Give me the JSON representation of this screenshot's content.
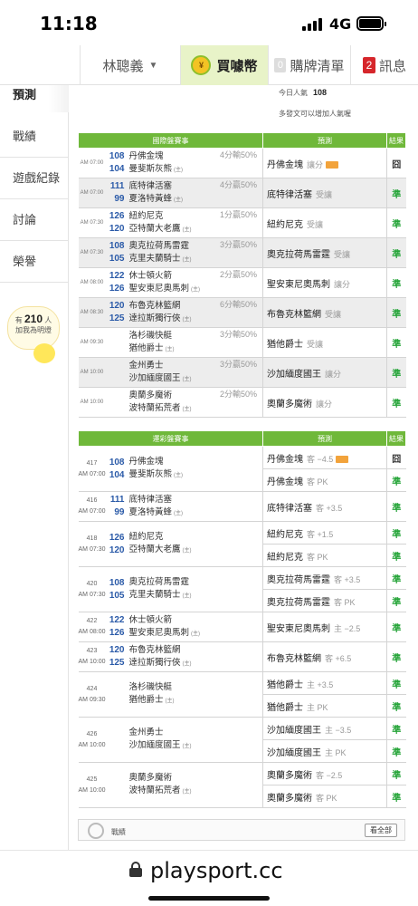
{
  "status": {
    "time": "11:18",
    "network": "4G"
  },
  "nav": {
    "username": "林聰義",
    "buy_label": "買噱幣",
    "cart_count": "0",
    "cart_label": "購牌清單",
    "msg_count": "2",
    "msg_label": "訊息"
  },
  "sidebar": {
    "items": [
      {
        "label": "預測"
      },
      {
        "label": "戰績"
      },
      {
        "label": "遊戲紀錄"
      },
      {
        "label": "討論"
      },
      {
        "label": "榮譽"
      }
    ],
    "pop_prefix": "有",
    "pop_count": "210",
    "pop_suffix": "人",
    "pop_line2": "加我為明燈"
  },
  "popularity": {
    "today_label": "今日人氣",
    "today_value": "108",
    "hint": "多發文可以增加人氣喔"
  },
  "intl": {
    "headers": [
      "國際盤賽事",
      "預測",
      "結果"
    ],
    "rows": [
      {
        "time": "AM 07:00",
        "n1": "108",
        "n2": "104",
        "t1": "丹佛金塊",
        "t2": "曼斐斯灰熊",
        "home": "(主)",
        "o1": "4分輸50%",
        "o2": "",
        "pick": "丹佛金塊",
        "pick_sub": "讓分",
        "hot": true,
        "result": "囧",
        "win": false
      },
      {
        "time": "AM 07:00",
        "n1": "111",
        "n2": "99",
        "t1": "底特律活塞",
        "t2": "夏洛特黃蜂",
        "home": "(主)",
        "o1": "",
        "o2": "4分贏50%",
        "pick": "底特律活塞",
        "pick_sub": "受讓",
        "hot": false,
        "result": "準",
        "win": true
      },
      {
        "time": "AM 07:30",
        "n1": "126",
        "n2": "120",
        "t1": "紐約尼克",
        "t2": "亞特蘭大老鷹",
        "home": "(主)",
        "o1": "",
        "o2": "1分贏50%",
        "pick": "紐約尼克",
        "pick_sub": "受讓",
        "hot": false,
        "result": "準",
        "win": true
      },
      {
        "time": "AM 07:30",
        "n1": "108",
        "n2": "105",
        "t1": "奧克拉荷馬雷霆",
        "t2": "克里夫蘭騎士",
        "home": "(主)",
        "o1": "",
        "o2": "3分贏50%",
        "pick": "奧克拉荷馬雷霆",
        "pick_sub": "受讓",
        "hot": false,
        "result": "準",
        "win": true
      },
      {
        "time": "AM 08:00",
        "n1": "122",
        "n2": "126",
        "t1": "休士頓火箭",
        "t2": "聖安東尼奧馬刺",
        "home": "(主)",
        "o1": "",
        "o2": "2分贏50%",
        "pick": "聖安東尼奧馬刺",
        "pick_sub": "讓分",
        "hot": false,
        "result": "準",
        "win": true
      },
      {
        "time": "AM 08:30",
        "n1": "120",
        "n2": "125",
        "t1": "布魯克林籃網",
        "t2": "達拉斯獨行俠",
        "home": "(主)",
        "o1": "",
        "o2": "6分輸50%",
        "pick": "布魯克林籃網",
        "pick_sub": "受讓",
        "hot": false,
        "result": "準",
        "win": true
      },
      {
        "time": "AM 09:30",
        "n1": "",
        "n2": "",
        "t1": "洛杉磯快艇",
        "t2": "猶他爵士",
        "home": "(主)",
        "o1": "3分輸50%",
        "o2": "",
        "pick": "猶他爵士",
        "pick_sub": "受讓",
        "hot": false,
        "result": "準",
        "win": true
      },
      {
        "time": "AM 10:00",
        "n1": "",
        "n2": "",
        "t1": "金州勇士",
        "t2": "沙加緬度國王",
        "home": "(主)",
        "o1": "",
        "o2": "3分贏50%",
        "pick": "沙加緬度國王",
        "pick_sub": "讓分",
        "hot": false,
        "result": "準",
        "win": true
      },
      {
        "time": "AM 10:00",
        "n1": "",
        "n2": "",
        "t1": "奧蘭多魔術",
        "t2": "波特蘭拓荒者",
        "home": "(主)",
        "o1": "2分輸50%",
        "o2": "",
        "pick": "奧蘭多魔術",
        "pick_sub": "讓分",
        "hot": false,
        "result": "準",
        "win": true
      }
    ]
  },
  "lottery": {
    "headers": [
      "運彩盤賽事",
      "預測",
      "結果"
    ],
    "rows": [
      {
        "gid": "417",
        "time": "AM 07:00",
        "n1": "108",
        "n2": "104",
        "t1": "丹佛金塊",
        "t2": "曼斐斯灰熊",
        "home": "(主)",
        "picks": [
          {
            "team": "丹佛金塊",
            "line": "客 −4.5",
            "hot": true,
            "result": "囧",
            "win": false
          },
          {
            "team": "丹佛金塊",
            "line": "客 PK",
            "hot": false,
            "result": "準",
            "win": true
          }
        ]
      },
      {
        "gid": "416",
        "time": "AM 07:00",
        "n1": "111",
        "n2": "99",
        "t1": "底特律活塞",
        "t2": "夏洛特黃蜂",
        "home": "(主)",
        "picks": [
          {
            "team": "底特律活塞",
            "line": "客 +3.5",
            "hot": false,
            "result": "準",
            "win": true
          }
        ]
      },
      {
        "gid": "418",
        "time": "AM 07:30",
        "n1": "126",
        "n2": "120",
        "t1": "紐約尼克",
        "t2": "亞特蘭大老鷹",
        "home": "(主)",
        "picks": [
          {
            "team": "紐約尼克",
            "line": "客 +1.5",
            "hot": false,
            "result": "準",
            "win": true
          },
          {
            "team": "紐約尼克",
            "line": "客 PK",
            "hot": false,
            "result": "準",
            "win": true
          }
        ]
      },
      {
        "gid": "420",
        "time": "AM 07:30",
        "n1": "108",
        "n2": "105",
        "t1": "奧克拉荷馬雷霆",
        "t2": "克里夫蘭騎士",
        "home": "(主)",
        "picks": [
          {
            "team": "奧克拉荷馬雷霆",
            "line": "客 +3.5",
            "hot": false,
            "result": "準",
            "win": true
          },
          {
            "team": "奧克拉荷馬雷霆",
            "line": "客 PK",
            "hot": false,
            "result": "準",
            "win": true
          }
        ]
      },
      {
        "gid": "422",
        "time": "AM 08:00",
        "n1": "122",
        "n2": "126",
        "t1": "休士頓火箭",
        "t2": "聖安東尼奧馬刺",
        "home": "(主)",
        "picks": [
          {
            "team": "聖安東尼奧馬刺",
            "line": "主 −2.5",
            "hot": false,
            "result": "準",
            "win": true
          }
        ]
      },
      {
        "gid": "423",
        "time": "AM 10:00",
        "n1": "120",
        "n2": "125",
        "t1": "布魯克林籃網",
        "t2": "達拉斯獨行俠",
        "home": "(主)",
        "picks": [
          {
            "team": "布魯克林籃網",
            "line": "客 +6.5",
            "hot": false,
            "result": "準",
            "win": true
          }
        ]
      },
      {
        "gid": "424",
        "time": "AM 09:30",
        "n1": "",
        "n2": "",
        "t1": "洛杉磯快艇",
        "t2": "猶他爵士",
        "home": "(主)",
        "picks": [
          {
            "team": "猶他爵士",
            "line": "主 +3.5",
            "hot": false,
            "result": "準",
            "win": true
          },
          {
            "team": "猶他爵士",
            "line": "主 PK",
            "hot": false,
            "result": "準",
            "win": true
          }
        ]
      },
      {
        "gid": "426",
        "time": "AM 10:00",
        "n1": "",
        "n2": "",
        "t1": "金州勇士",
        "t2": "沙加緬度國王",
        "home": "(主)",
        "picks": [
          {
            "team": "沙加緬度國王",
            "line": "主 −3.5",
            "hot": false,
            "result": "準",
            "win": true
          },
          {
            "team": "沙加緬度國王",
            "line": "主 PK",
            "hot": false,
            "result": "準",
            "win": true
          }
        ]
      },
      {
        "gid": "425",
        "time": "AM 10:00",
        "n1": "",
        "n2": "",
        "t1": "奧蘭多魔術",
        "t2": "波特蘭拓荒者",
        "home": "(主)",
        "picks": [
          {
            "team": "奧蘭多魔術",
            "line": "客 −2.5",
            "hot": false,
            "result": "準",
            "win": true
          },
          {
            "team": "奧蘭多魔術",
            "line": "客 PK",
            "hot": false,
            "result": "準",
            "win": true
          }
        ]
      }
    ]
  },
  "record": {
    "label": "戰績",
    "more": "看全部"
  },
  "browser": {
    "url": "playsport.cc"
  }
}
